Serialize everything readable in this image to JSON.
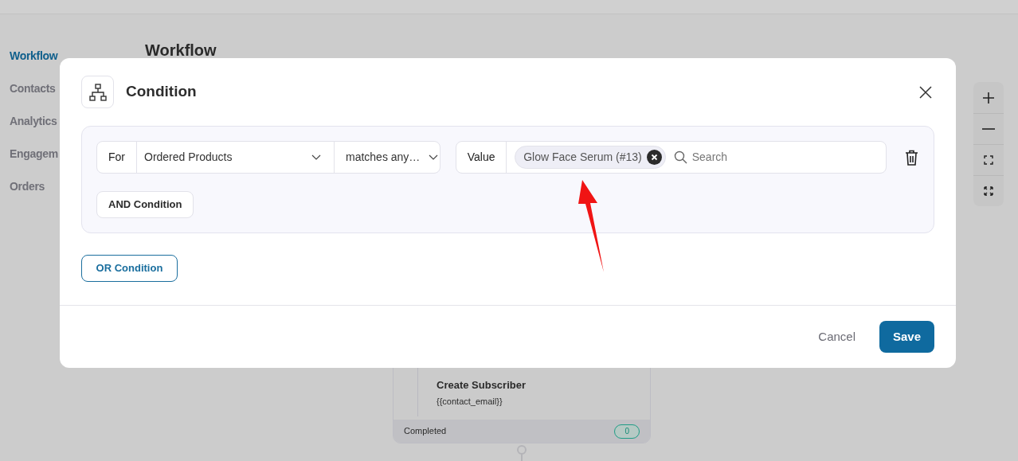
{
  "sidebar": {
    "items": [
      {
        "label": "Workflow",
        "selected": true
      },
      {
        "label": "Contacts",
        "selected": false
      },
      {
        "label": "Analytics",
        "selected": false
      },
      {
        "label": "Engagem",
        "selected": false
      },
      {
        "label": "Orders",
        "selected": false
      }
    ]
  },
  "page": {
    "title": "Workflow"
  },
  "workflow_node": {
    "title": "Create Subscriber",
    "subtitle": "{{contact_email}}",
    "status": "Completed",
    "count": "0"
  },
  "dialog": {
    "title": "Condition",
    "rule": {
      "for_label": "For",
      "field": "Ordered Products",
      "operator": "matches any…",
      "value_label": "Value",
      "tags": [
        "Glow Face Serum (#13)"
      ],
      "search_placeholder": "Search"
    },
    "and_button": "AND Condition",
    "or_button": "OR Condition",
    "cancel": "Cancel",
    "save": "Save"
  }
}
